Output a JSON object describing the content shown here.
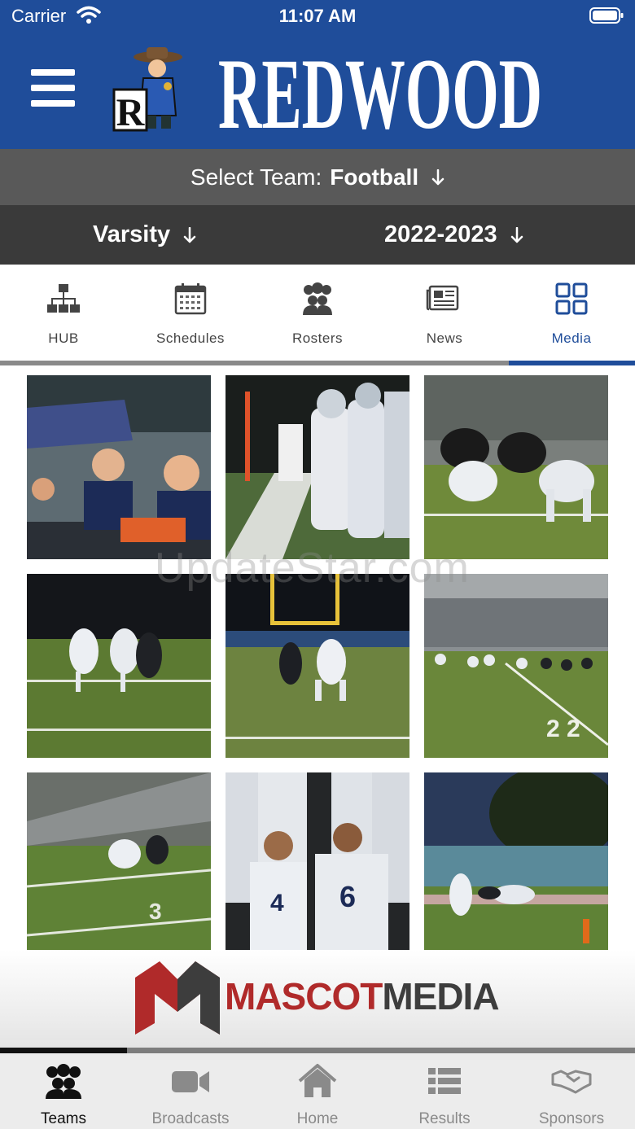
{
  "status_bar": {
    "carrier": "Carrier",
    "time": "11:07 AM"
  },
  "header": {
    "school_name": "REDWOOD",
    "menu_icon": "hamburger-menu-icon",
    "logo_icon": "redwood-mascot-logo",
    "brand_color": "#1f4d9a"
  },
  "team_selector": {
    "label": "Select Team:",
    "value": "Football"
  },
  "level_selector": {
    "level": "Varsity",
    "season": "2022-2023"
  },
  "tabs": [
    {
      "label": "HUB",
      "icon": "hub-hierarchy-icon",
      "active": false
    },
    {
      "label": "Schedules",
      "icon": "calendar-icon",
      "active": false
    },
    {
      "label": "Rosters",
      "icon": "people-group-icon",
      "active": false
    },
    {
      "label": "News",
      "icon": "newspaper-icon",
      "active": false
    },
    {
      "label": "Media",
      "icon": "grid-icon",
      "active": true
    }
  ],
  "media": {
    "photo_count": 9,
    "watermark": "UpdateStar.com"
  },
  "sponsor_banner": {
    "part1": "MASCOT",
    "part2": "MEDIA",
    "colors": [
      "#b02a2a",
      "#3d3d3d"
    ]
  },
  "bottom_nav": [
    {
      "label": "Teams",
      "icon": "teams-people-icon",
      "active": true
    },
    {
      "label": "Broadcasts",
      "icon": "video-camera-icon",
      "active": false
    },
    {
      "label": "Home",
      "icon": "home-icon",
      "active": false
    },
    {
      "label": "Results",
      "icon": "list-icon",
      "active": false
    },
    {
      "label": "Sponsors",
      "icon": "handshake-icon",
      "active": false
    }
  ]
}
